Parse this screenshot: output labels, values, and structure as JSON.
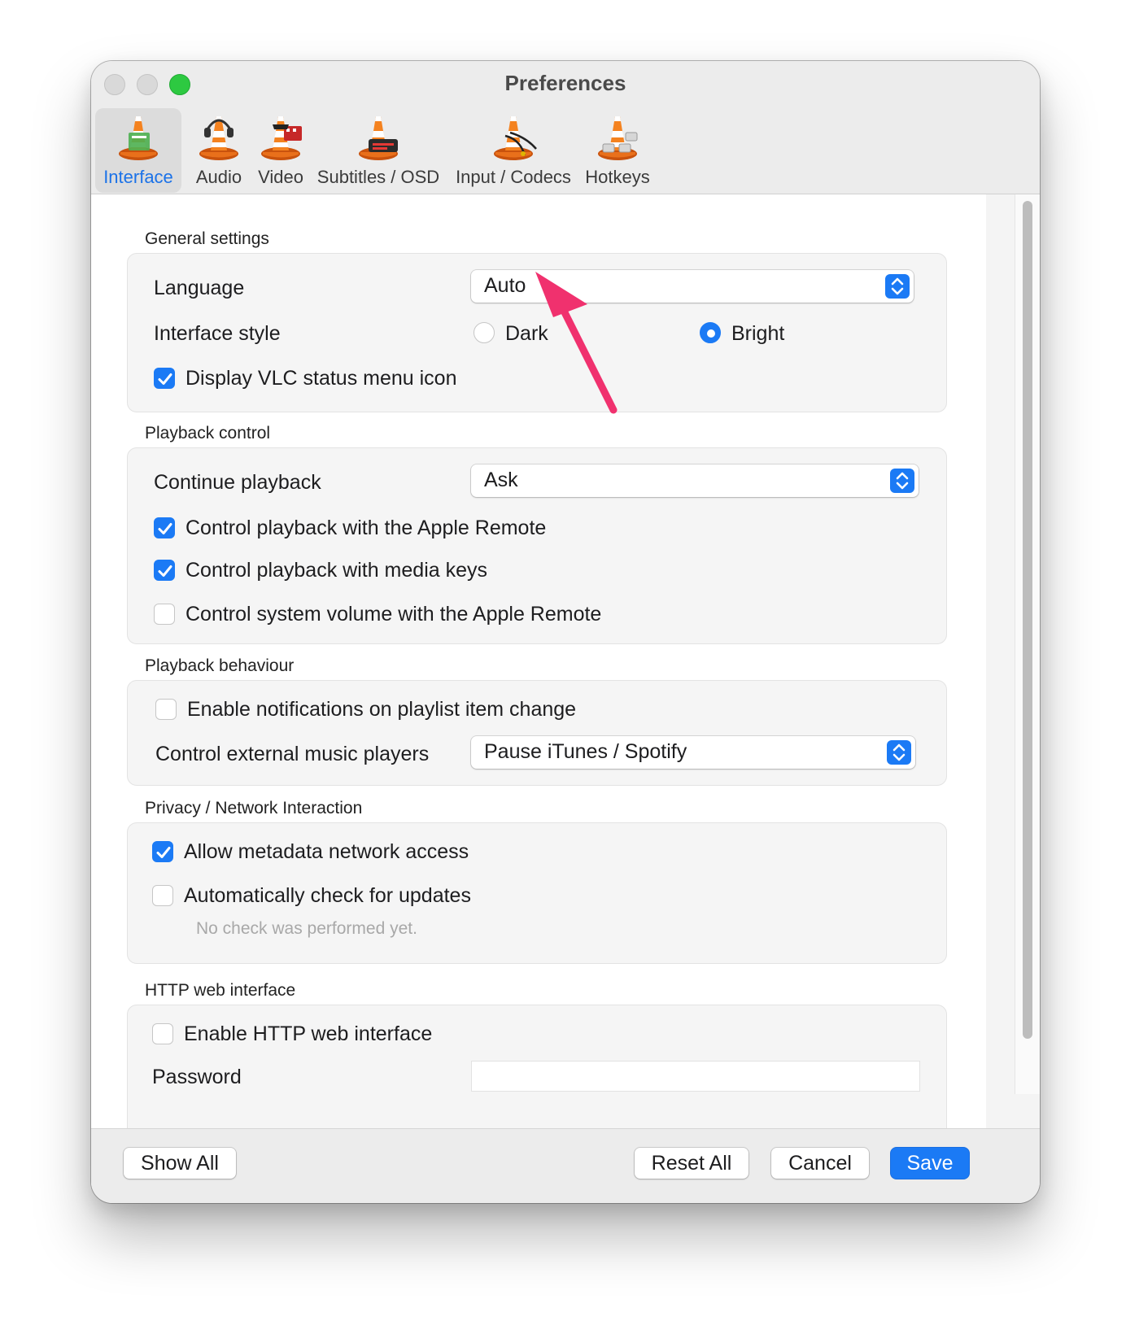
{
  "window": {
    "title": "Preferences"
  },
  "tabs": [
    {
      "label": "Interface",
      "icon": "vlc-cone-interface-icon",
      "selected": true
    },
    {
      "label": "Audio",
      "icon": "vlc-cone-audio-icon",
      "selected": false
    },
    {
      "label": "Video",
      "icon": "vlc-cone-video-icon",
      "selected": false
    },
    {
      "label": "Subtitles / OSD",
      "icon": "vlc-cone-subtitles-icon",
      "selected": false
    },
    {
      "label": "Input / Codecs",
      "icon": "vlc-cone-input-icon",
      "selected": false
    },
    {
      "label": "Hotkeys",
      "icon": "vlc-cone-hotkeys-icon",
      "selected": false
    }
  ],
  "general": {
    "title": "General settings",
    "language_label": "Language",
    "language_value": "Auto",
    "style_label": "Interface style",
    "style_dark": "Dark",
    "style_bright": "Bright",
    "style_selected": "Bright",
    "status_icon_label": "Display VLC status menu icon",
    "status_icon_checked": true
  },
  "playback_control": {
    "title": "Playback control",
    "continue_label": "Continue playback",
    "continue_value": "Ask",
    "apple_remote_label": "Control playback with the Apple Remote",
    "apple_remote_checked": true,
    "media_keys_label": "Control playback with media keys",
    "media_keys_checked": true,
    "system_volume_label": "Control system volume with the Apple Remote",
    "system_volume_checked": false
  },
  "playback_behaviour": {
    "title": "Playback behaviour",
    "notifications_label": "Enable notifications on playlist item change",
    "notifications_checked": false,
    "external_label": "Control external music players",
    "external_value": "Pause iTunes / Spotify"
  },
  "privacy": {
    "title": "Privacy / Network Interaction",
    "metadata_label": "Allow metadata network access",
    "metadata_checked": true,
    "updates_label": "Automatically check for updates",
    "updates_checked": false,
    "updates_note": "No check was performed yet."
  },
  "http": {
    "title": "HTTP web interface",
    "enable_label": "Enable HTTP web interface",
    "enable_checked": false,
    "password_label": "Password",
    "password_value": ""
  },
  "buttons": {
    "show_all": "Show All",
    "reset_all": "Reset All",
    "cancel": "Cancel",
    "save": "Save"
  },
  "colors": {
    "accent": "#1b7af5",
    "annotation_arrow": "#f0316e",
    "zoom_button": "#2dc941"
  }
}
